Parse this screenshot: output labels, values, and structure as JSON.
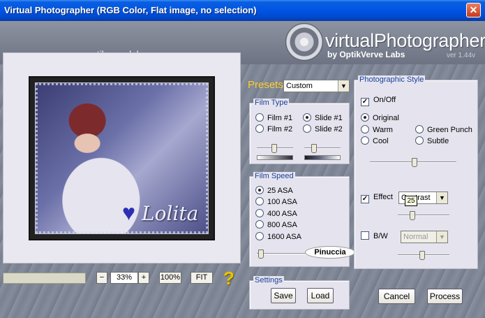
{
  "window": {
    "title": "Virtual Photographer (RGB Color, Flat image, no selection)",
    "close_glyph": "✕"
  },
  "header": {
    "url": "www.optikvervelabs.com",
    "logo_text": "virtualPhotographer",
    "logo_sub": "by OptikVerve Labs",
    "version": "ver 1.44v"
  },
  "preview": {
    "signature": "Lolita",
    "watermark": "Pinuccia"
  },
  "zoom": {
    "minus": "−",
    "value": "33%",
    "plus": "+",
    "full_label": "100%",
    "fit_label": "FIT",
    "help": "?",
    "progress_fraction": 0.0
  },
  "presets": {
    "label": "Presets",
    "selected": "Custom"
  },
  "film_type": {
    "title": "Film Type",
    "options": [
      {
        "label": "Film #1",
        "selected": false
      },
      {
        "label": "Slide #1",
        "selected": true
      },
      {
        "label": "Film #2",
        "selected": false
      },
      {
        "label": "Slide #2",
        "selected": false
      }
    ],
    "slider1_level": 0.48,
    "slider2_level": 0.22
  },
  "film_speed": {
    "title": "Film Speed",
    "options": [
      {
        "label": "25 ASA",
        "selected": true
      },
      {
        "label": "100 ASA",
        "selected": false
      },
      {
        "label": "400 ASA",
        "selected": false
      },
      {
        "label": "800 ASA",
        "selected": false
      },
      {
        "label": "1600 ASA",
        "selected": false
      }
    ],
    "slider_level": 0.02
  },
  "photo_style": {
    "title": "Photographic Style",
    "onoff_label": "On/Off",
    "onoff_checked": true,
    "styles": [
      {
        "label": "Original",
        "selected": true
      },
      {
        "label": "Warm",
        "selected": false
      },
      {
        "label": "Green Punch",
        "selected": false
      },
      {
        "label": "Cool",
        "selected": false
      },
      {
        "label": "Subtle",
        "selected": false
      }
    ],
    "style_slider_level": 0.52,
    "effect_label": "Effect",
    "effect_checked": true,
    "effect_value": "Contrast",
    "effect_slider_level": 0.25,
    "tooltip": "25",
    "bw_label": "B/W",
    "bw_checked": false,
    "bw_value": "Normal",
    "bw_slider_level": 0.47
  },
  "settings": {
    "title": "Settings",
    "save_label": "Save",
    "load_label": "Load"
  },
  "actions": {
    "cancel_label": "Cancel",
    "process_label": "Process"
  },
  "colors": {
    "title_bar": "#0054e3",
    "presets_label": "#ffcf2a",
    "group_title": "#1a3f9a",
    "help_icon": "#e8c400"
  }
}
